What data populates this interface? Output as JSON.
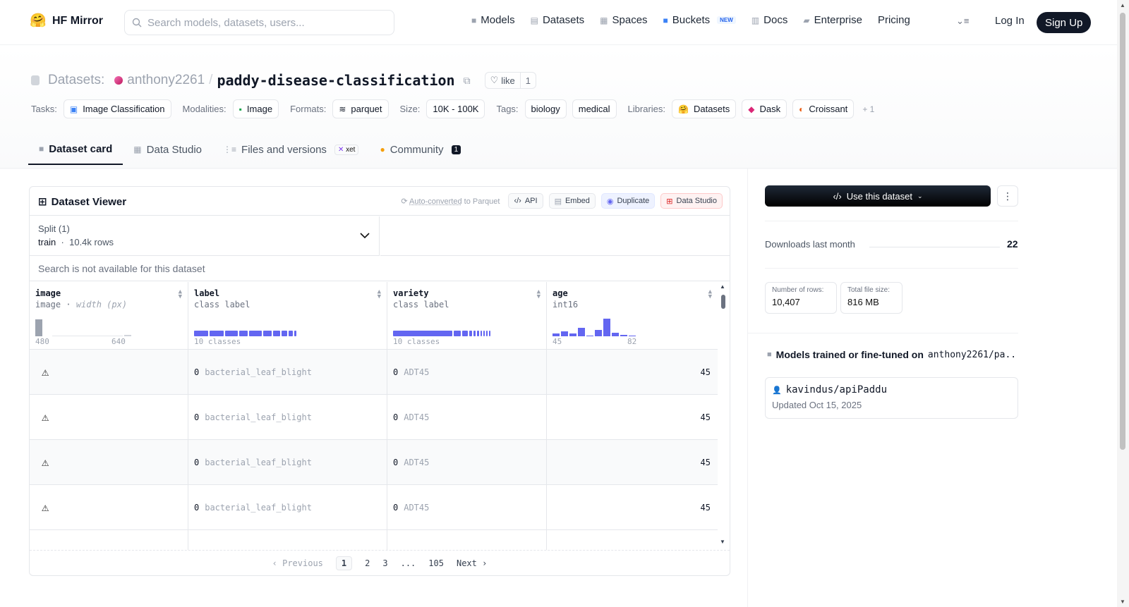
{
  "brand": {
    "name": "HF Mirror"
  },
  "search": {
    "placeholder": "Search models, datasets, users..."
  },
  "nav": [
    {
      "label": "Models",
      "icon": "cube-icon"
    },
    {
      "label": "Datasets",
      "icon": "database-icon"
    },
    {
      "label": "Spaces",
      "icon": "grid-icon"
    },
    {
      "label": "Buckets",
      "icon": "bucket-icon",
      "badge": "NEW"
    },
    {
      "label": "Docs",
      "icon": "book-icon"
    },
    {
      "label": "Enterprise",
      "icon": "enterprise-icon"
    },
    {
      "label": "Pricing"
    }
  ],
  "auth": {
    "login": "Log In",
    "signup": "Sign Up"
  },
  "title": {
    "prefix": "Datasets:",
    "owner": "anthony2261",
    "sep": "/",
    "repo": "paddy-disease-classification",
    "like_label": "like",
    "like_count": "1"
  },
  "tags": {
    "tasks_label": "Tasks:",
    "task": "Image Classification",
    "modalities_label": "Modalities:",
    "modality": "Image",
    "formats_label": "Formats:",
    "format": "parquet",
    "size_label": "Size:",
    "size": "10K - 100K",
    "tags_label": "Tags:",
    "tag1": "biology",
    "tag2": "medical",
    "libraries_label": "Libraries:",
    "lib1": "Datasets",
    "lib2": "Dask",
    "lib3": "Croissant",
    "more": "+ 1"
  },
  "tabs": {
    "card": "Dataset card",
    "studio": "Data Studio",
    "files": "Files and versions",
    "xet": "xet",
    "community": "Community",
    "community_count": "1"
  },
  "viewer": {
    "title": "Dataset Viewer",
    "auto_converted": "Auto-converted",
    "to_parquet": "to Parquet",
    "api": "API",
    "embed": "Embed",
    "duplicate": "Duplicate",
    "studio": "Data Studio",
    "split_title": "Split (1)",
    "split_name": "train",
    "split_sep": "·",
    "split_rows": "10.4k rows",
    "search_na": "Search is not available for this dataset",
    "columns": [
      {
        "name": "image",
        "type": "image",
        "type_extra": "width (px)",
        "min": "480",
        "max": "640"
      },
      {
        "name": "label",
        "type": "class label",
        "foot": "10 classes"
      },
      {
        "name": "variety",
        "type": "class label",
        "foot": "10 classes"
      },
      {
        "name": "age",
        "type": "int16",
        "min": "45",
        "max": "82"
      }
    ],
    "rows": [
      {
        "label_idx": "0",
        "label": "bacterial_leaf_blight",
        "variety_idx": "0",
        "variety": "ADT45",
        "age": "45"
      },
      {
        "label_idx": "0",
        "label": "bacterial_leaf_blight",
        "variety_idx": "0",
        "variety": "ADT45",
        "age": "45"
      },
      {
        "label_idx": "0",
        "label": "bacterial_leaf_blight",
        "variety_idx": "0",
        "variety": "ADT45",
        "age": "45"
      },
      {
        "label_idx": "0",
        "label": "bacterial_leaf_blight",
        "variety_idx": "0",
        "variety": "ADT45",
        "age": "45"
      }
    ],
    "pager": {
      "prev": "Previous",
      "p1": "1",
      "p2": "2",
      "p3": "3",
      "ellipsis": "...",
      "last": "105",
      "next": "Next"
    }
  },
  "sidebar": {
    "use_dataset": "Use this dataset",
    "downloads_label": "Downloads last month",
    "downloads_value": "22",
    "rows_label": "Number of rows:",
    "rows_value": "10,407",
    "size_label": "Total file size:",
    "size_value": "816 MB",
    "trained_label": "Models trained or fine-tuned on",
    "trained_repo": "anthony2261/pa...",
    "model_name": "kavindus/apiPaddu",
    "model_updated": "Updated Oct 15, 2025"
  },
  "colors": {
    "accent": "#6366f1",
    "dark": "#111827"
  }
}
